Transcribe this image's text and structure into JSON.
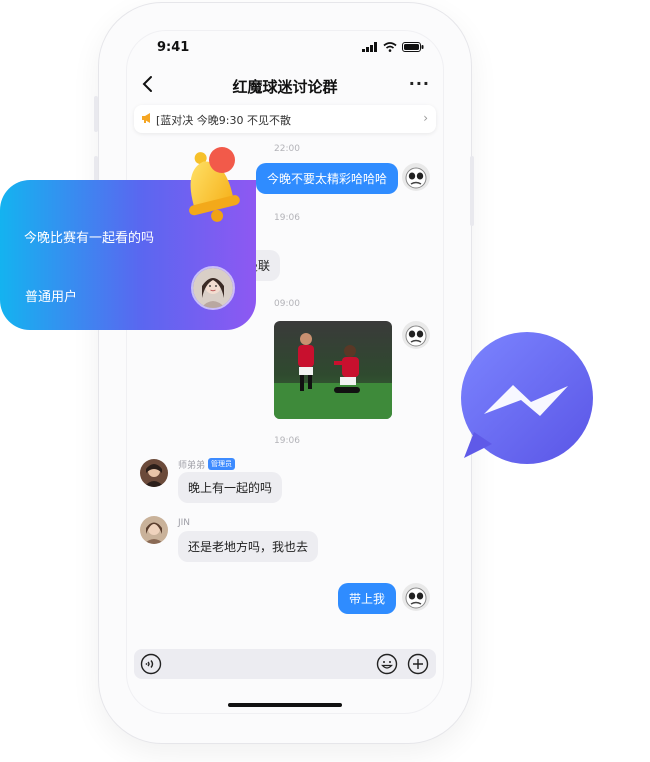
{
  "status_bar": {
    "time": "9:41"
  },
  "nav": {
    "title": "红魔球迷讨论群"
  },
  "notice": {
    "text": "[蓝对决 今晚9:30 不见不散"
  },
  "messages": {
    "m1": {
      "time": "22:00",
      "text": "今晚不要太精彩哈哈哈"
    },
    "m2": {
      "time": "19:06",
      "text": "曼联"
    },
    "m3": {
      "time": "09:00"
    },
    "m4": {
      "time": "19:06",
      "sender": "师弟弟",
      "badge": "管理员",
      "text": "晚上有一起的吗"
    },
    "m5": {
      "sender": "JIN",
      "text": "还是老地方吗，我也去"
    },
    "m6": {
      "text": "带上我"
    }
  },
  "card": {
    "message": "今晚比赛有一起看的吗",
    "role": "普通用户"
  },
  "colors": {
    "accent": "#2f8cff",
    "card_start": "#14b3f0",
    "card_end": "#8e58f2",
    "messenger": "#6a6ff6",
    "notify_dot": "#f25a4a"
  },
  "icons": [
    "back-icon",
    "more-icon",
    "megaphone-icon",
    "voice-icon",
    "emoji-icon",
    "add-icon",
    "bell-icon",
    "messenger-icon"
  ]
}
